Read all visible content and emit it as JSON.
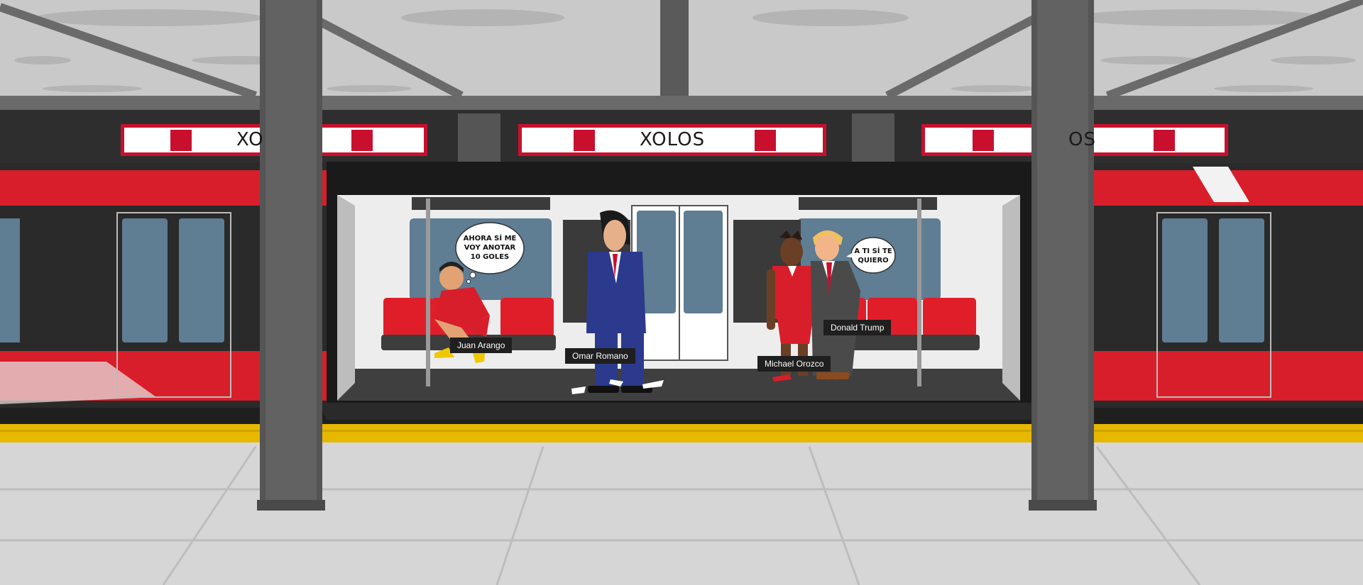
{
  "station": {
    "signs": [
      {
        "text": "XO"
      },
      {
        "text": "XOLOS"
      },
      {
        "text": "OS"
      }
    ]
  },
  "characters": [
    {
      "name": "Juan Arango"
    },
    {
      "name": "Omar Romano"
    },
    {
      "name": "Michael Orozco"
    },
    {
      "name": "Donald Trump"
    }
  ],
  "bubbles": {
    "thought": {
      "lines": [
        "AHORA SÍ ME",
        "VOY ANOTAR",
        "10 GOLES"
      ]
    },
    "speech": {
      "lines": [
        "A TI SÍ TE",
        "QUIERO"
      ]
    }
  },
  "colors": {
    "train_red": "#e0202c",
    "platform_yellow": "#e6b800",
    "pillar": "#555555",
    "suit_blue": "#2b3a8c"
  }
}
